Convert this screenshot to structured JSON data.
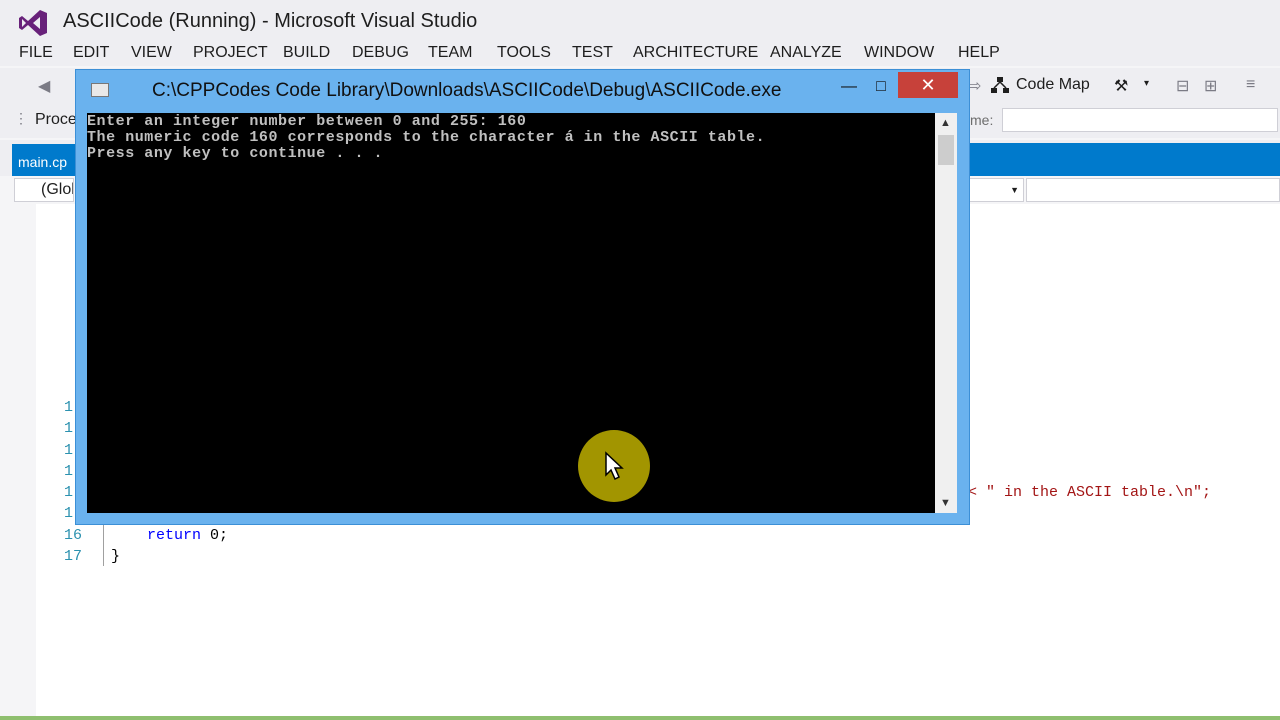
{
  "window": {
    "title": "ASCIICode (Running) - Microsoft Visual Studio"
  },
  "menu": [
    "FILE",
    "EDIT",
    "VIEW",
    "PROJECT",
    "BUILD",
    "DEBUG",
    "TEAM",
    "TOOLS",
    "TEST",
    "ARCHITECTURE",
    "ANALYZE",
    "WINDOW",
    "HELP"
  ],
  "toolbar": {
    "code_map_label": "Code Map",
    "process_label": "Proce",
    "name_label": "me:"
  },
  "tabs": {
    "active_file": "main.cp"
  },
  "navbar": {
    "scope": "(Glol"
  },
  "editor": {
    "gutter_numbers": [
      "1",
      "1",
      "1",
      "1",
      "1",
      "1",
      "16",
      "17"
    ],
    "line_output_tail": "< \" in the ASCII table.\\n\";",
    "return_keyword": "return",
    "return_value": " 0;",
    "closing_brace": "}"
  },
  "console": {
    "title": "C:\\CPPCodes Code Library\\Downloads\\ASCIICode\\Debug\\ASCIICode.exe",
    "lines": [
      "Enter an integer number between 0 and 255: 160",
      "The numeric code 160 corresponds to the character á in the ASCII table.",
      "Press any key to continue . . ."
    ],
    "close_glyph": "✕",
    "minimize_glyph": "—",
    "maximize_glyph": "□"
  },
  "colors": {
    "accent": "#007acc",
    "console_frame": "#6ab2ee",
    "close_button": "#c7413a",
    "cursor_highlight": "#beaf00"
  }
}
